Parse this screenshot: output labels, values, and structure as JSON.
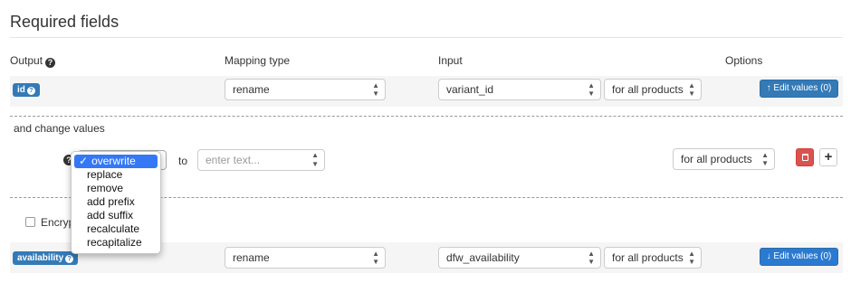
{
  "title": "Required fields",
  "headers": {
    "output": "Output",
    "mapping_type": "Mapping type",
    "input": "Input",
    "options": "Options"
  },
  "rows": [
    {
      "badge": "id",
      "mapping": "rename",
      "input": "variant_id",
      "scope": "for all products",
      "edit_button": "Edit values (0)",
      "edit_icon": "arrow-up-icon"
    },
    {
      "badge": "availability",
      "mapping": "rename",
      "input": "dfw_availability",
      "scope": "for all products",
      "edit_button": "Edit values (0)",
      "edit_icon": "arrow-down-icon"
    }
  ],
  "change_values": {
    "label": "and change values",
    "to_label": "to",
    "text_placeholder": "enter text...",
    "scope": "for all products",
    "dropdown": {
      "selected": "overwrite",
      "options": [
        "overwrite",
        "replace",
        "remove",
        "add prefix",
        "add suffix",
        "recalculate",
        "recapitalize"
      ]
    },
    "add_label": "+"
  },
  "encrypt": {
    "label": "Encryp",
    "checked": false
  },
  "colors": {
    "primary": "#337ab7",
    "danger": "#d9534f",
    "menu_highlight": "#3478f6"
  }
}
